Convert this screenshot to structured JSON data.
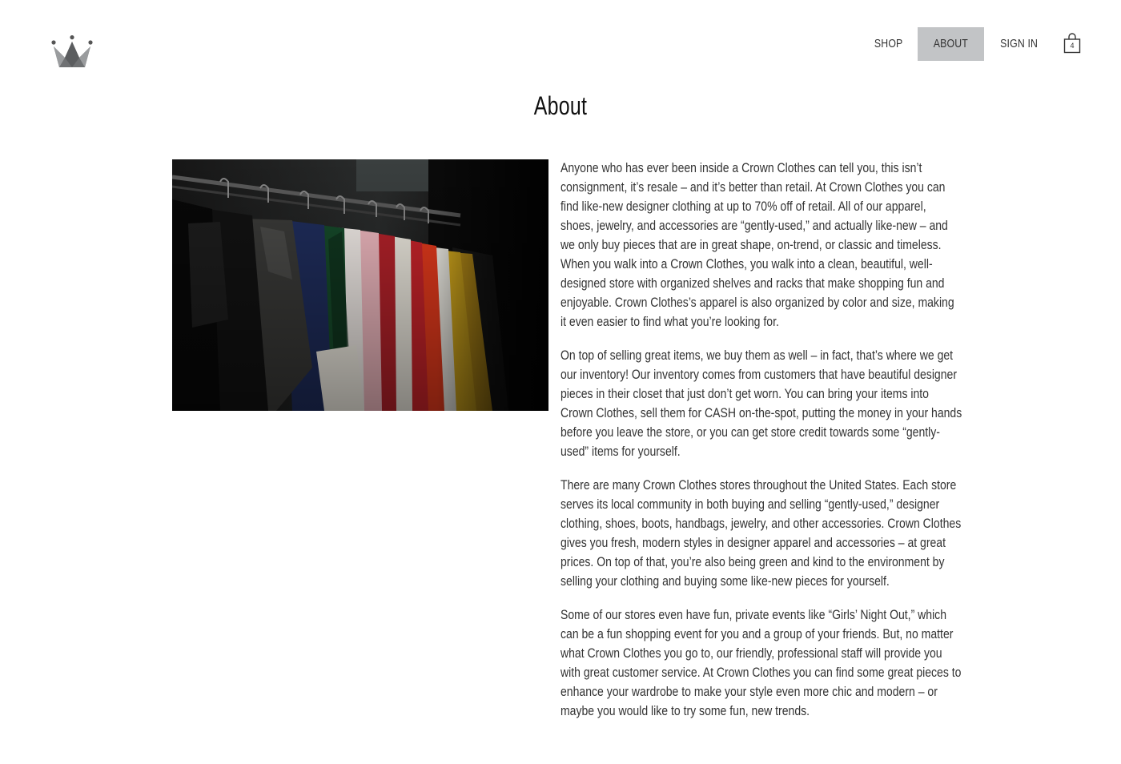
{
  "header": {
    "nav": [
      {
        "label": "SHOP",
        "active": false
      },
      {
        "label": "ABOUT",
        "active": true
      },
      {
        "label": "SIGN IN",
        "active": false
      }
    ],
    "cart_count": "4",
    "logo_icon": "crown-icon",
    "cart_icon": "shopping-bag-icon"
  },
  "main": {
    "title": "About",
    "image_icon": "clothing-rack-photo",
    "paragraphs": [
      "Anyone who has ever been inside a Crown Clothes can tell you, this isn’t consignment, it’s resale – and it’s better than retail. At Crown Clothes you can find like-new designer clothing at up to 70% off of retail. All of our apparel, shoes, jewelry, and accessories are “gently-used,” and actually like-new – and we only buy pieces that are in great shape, on-trend, or classic and timeless. When you walk into a Crown Clothes, you walk into a clean, beautiful, well-designed store with organized shelves and racks that make shopping fun and enjoyable. Crown Clothes’s apparel is also organized by color and size, making it even easier to find what you’re looking for.",
      "On top of selling great items, we buy them as well – in fact, that’s where we get our inventory! Our inventory comes from customers that have beautiful designer pieces in their closet that just don’t get worn. You can bring your items into Crown Clothes, sell them for CASH on-the-spot, putting the money in your hands before you leave the store, or you can get store credit towards some “gently-used” items for yourself.",
      "There are many Crown Clothes stores throughout the United States. Each store serves its local community in both buying and selling “gently-used,” designer clothing, shoes, boots, handbags, jewelry, and other accessories. Crown Clothes gives you fresh, modern styles in designer apparel and accessories – at great prices. On top of that, you’re also being green and kind to the environment by selling your clothing and buying some like-new pieces for yourself.",
      "Some of our stores even have fun, private events like “Girls’ Night Out,” which can be a fun shopping event for you and a group of your friends. But, no matter what Crown Clothes you go to, our friendly, professional staff will provide you with great customer service. At Crown Clothes you can find some great pieces to enhance your wardrobe to make your style even more chic and modern – or maybe you would like to try some fun, new trends."
    ]
  },
  "colors": {
    "active_nav_bg": "#c2c4c6",
    "text": "#333333",
    "title": "#111111"
  }
}
